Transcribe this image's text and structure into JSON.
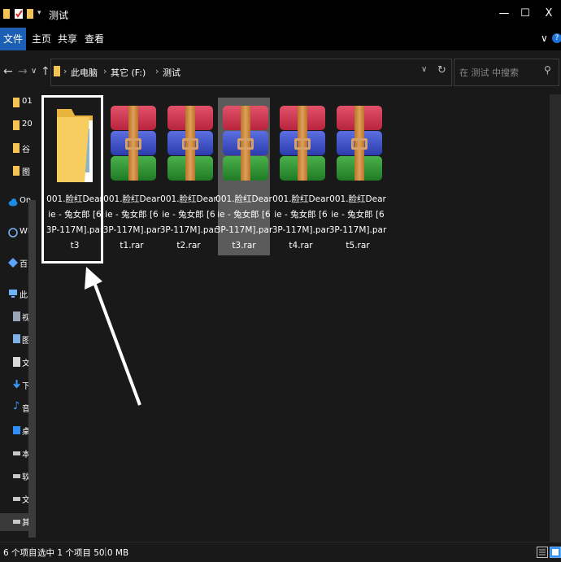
{
  "window": {
    "title": "测试",
    "minimize_glyph": "—",
    "maximize_glyph": "☐",
    "close_glyph": "X"
  },
  "ribbon": {
    "tabs": [
      "文件",
      "主页",
      "共享",
      "查看"
    ],
    "expand_glyph": "∨",
    "help_glyph": "?"
  },
  "address": {
    "back_glyph": "←",
    "forward_glyph": "→",
    "recent_glyph": "∨",
    "up_glyph": "↑",
    "breadcrumbs": [
      "此电脑",
      "其它 (F:)",
      "测试"
    ],
    "dropdown_glyph": "∨",
    "refresh_glyph": "↻",
    "search_placeholder": "在 测试 中搜索",
    "search_glyph": "⚲"
  },
  "nav_pane": {
    "items": [
      {
        "label": "01",
        "icon": "folder-icon"
      },
      {
        "label": "20",
        "icon": "folder-icon"
      },
      {
        "label": "谷",
        "icon": "folder-icon"
      },
      {
        "label": "图",
        "icon": "folder-icon"
      },
      {
        "label": "On",
        "icon": "cloud-icon"
      },
      {
        "label": "WP",
        "icon": "wps-icon"
      },
      {
        "label": "百",
        "icon": "baidu-icon"
      },
      {
        "label": "此",
        "icon": "computer-icon"
      },
      {
        "label": "视",
        "icon": "video-icon"
      },
      {
        "label": "图",
        "icon": "pictures-icon"
      },
      {
        "label": "文",
        "icon": "documents-icon"
      },
      {
        "label": "下",
        "icon": "downloads-icon"
      },
      {
        "label": "音",
        "icon": "music-icon"
      },
      {
        "label": "桌",
        "icon": "desktop-icon"
      },
      {
        "label": "本",
        "icon": "drive-icon"
      },
      {
        "label": "软",
        "icon": "drive-icon"
      },
      {
        "label": "文",
        "icon": "drive-icon"
      },
      {
        "label": "其",
        "icon": "drive-icon"
      }
    ]
  },
  "files": [
    {
      "name": "001.脸红Dearie - 兔女郎 [63P-117M].part3",
      "type": "folder",
      "selected": false
    },
    {
      "name": "001.脸红Dearie - 兔女郎 [63P-117M].part1.rar",
      "type": "rar",
      "selected": false
    },
    {
      "name": "001.脸红Dearie - 兔女郎 [63P-117M].part2.rar",
      "type": "rar",
      "selected": false
    },
    {
      "name": "001.脸红Dearie - 兔女郎 [63P-117M].part3.rar",
      "type": "rar",
      "selected": true
    },
    {
      "name": "001.脸红Dearie - 兔女郎 [63P-117M].part4.rar",
      "type": "rar",
      "selected": false
    },
    {
      "name": "001.脸红Dearie - 兔女郎 [63P-117M].part5.rar",
      "type": "rar",
      "selected": false
    }
  ],
  "status": {
    "item_count": "6 个项目",
    "selection": "选中 1 个项目  50.0 MB"
  },
  "colors": {
    "background": "#191919",
    "titlebar": "#000000",
    "file_tab": "#1a5fb4",
    "selection": "#5b5b5b",
    "folder": "#f3c454"
  }
}
